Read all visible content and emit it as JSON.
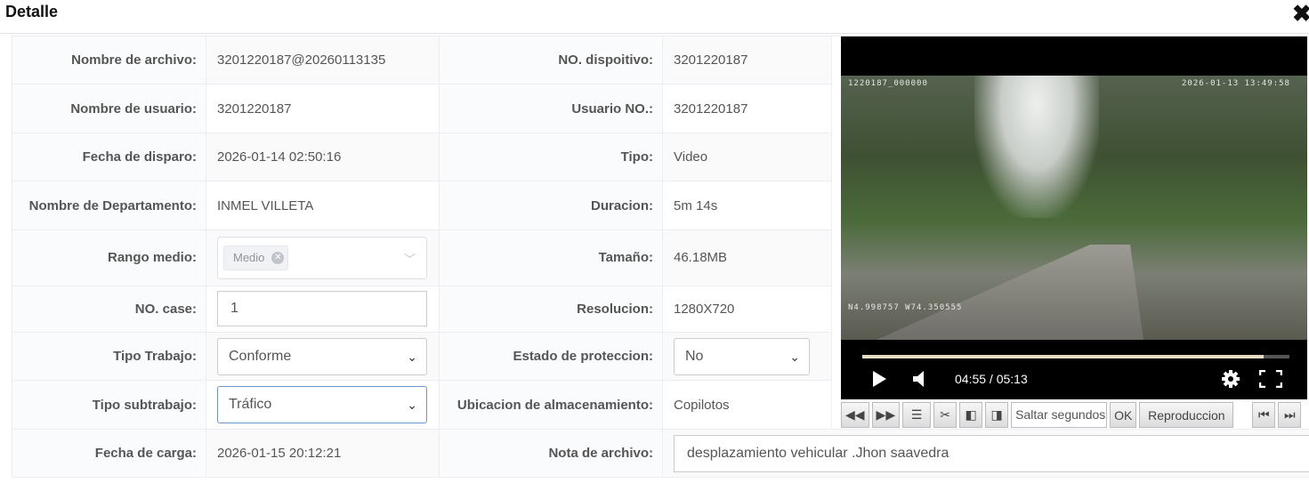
{
  "dialog": {
    "title": "Detalle",
    "close_glyph": "✖"
  },
  "rows": [
    {
      "label": "Nombre de archivo:",
      "value": "3201220187@20260113135",
      "label2": "NO. dispoitivo:",
      "value2": "3201220187"
    },
    {
      "label": "Nombre de usuario:",
      "value": "3201220187",
      "label2": "Usuario NO.:",
      "value2": "3201220187"
    },
    {
      "label": "Fecha de disparo:",
      "value": "2026-01-14 02:50:16",
      "label2": "Tipo:",
      "value2": "Video"
    },
    {
      "label": "Nombre de Departamento:",
      "value": "INMEL VILLETA",
      "label2": "Duracion:",
      "value2": "5m 14s"
    },
    {
      "label": "Rango medio:",
      "tag": "Medio",
      "label2": "Tamaño:",
      "value2": "46.18MB"
    },
    {
      "label": "NO. case:",
      "input_value": "1",
      "label2": "Resolucion:",
      "value2": "1280X720"
    },
    {
      "label": "Tipo Trabajo:",
      "select_value": "Conforme",
      "label2": "Estado de proteccion:",
      "select2_value": "No"
    },
    {
      "label": "Tipo subtrabajo:",
      "select_value": "Tráfico",
      "label2": "Ubicacion de almacenamiento:",
      "value2": "Copilotos"
    },
    {
      "label": "Fecha de carga:",
      "value": "2026-01-15 20:12:21",
      "label2": "Nota de archivo:",
      "input2_value": "desplazamiento vehicular .Jhon saavedra"
    }
  ],
  "video": {
    "overlay_id": "1220187_000000",
    "overlay_time": "2026-01-13  13:49:58",
    "overlay_gps": "N4.998757  W74.350555",
    "time": "04:55 / 05:13",
    "progress": 0.94
  },
  "toolbar": {
    "seek_placeholder": "Saltar segundos",
    "ok_label": "OK",
    "play_label": "Reproduccion"
  },
  "icons": {
    "play": "play-icon",
    "volume": "volume-icon",
    "settings": "gear-icon",
    "fullscreen": "fullscreen-icon",
    "rewind": "rewind-icon",
    "forward": "fast-forward-icon",
    "list": "list-icon",
    "cut": "scissors-icon",
    "prev_frame": "prev-frame-icon",
    "next_frame": "next-frame-icon",
    "first": "first-icon",
    "last": "last-icon"
  }
}
